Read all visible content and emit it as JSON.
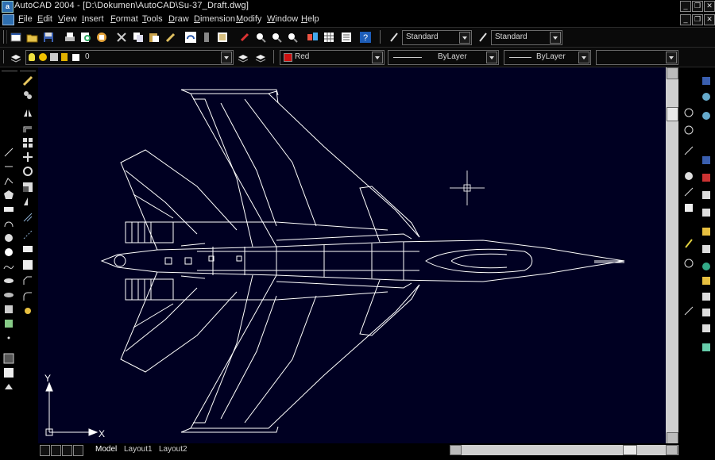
{
  "window": {
    "title": "AutoCAD 2004 - [D:\\Dokumen\\AutoCAD\\Su-37_Draft.dwg]",
    "app_icon_letter": "a"
  },
  "menu": [
    "File",
    "Edit",
    "View",
    "Insert",
    "Format",
    "Tools",
    "Draw",
    "Dimension",
    "Modify",
    "Window",
    "Help"
  ],
  "styles_toolbar": {
    "text_style": "Standard",
    "dim_style": "Standard"
  },
  "layers_toolbar": {
    "layer": "0",
    "color": "Red",
    "color_hex": "#cc1111",
    "linetype": "ByLayer",
    "lineweight": "ByLayer",
    "plotstyle": ""
  },
  "ucs": {
    "x_label": "X",
    "y_label": "Y"
  },
  "tabs": [
    "Model",
    "Layout1",
    "Layout2"
  ],
  "active_tab": "Model",
  "colors": {
    "canvas_bg": "#000022",
    "linework": "#ffffff"
  },
  "icons": [
    "new-icon",
    "open-icon",
    "save-icon",
    "plot-icon",
    "plot-preview-icon",
    "publish-icon",
    "cut-icon",
    "copy-icon",
    "paste-icon",
    "match-properties-icon",
    "undo-icon",
    "redo-icon",
    "pan-icon",
    "zoom-realtime-icon",
    "zoom-window-icon",
    "zoom-previous-icon",
    "properties-icon",
    "design-center-icon",
    "tool-palettes-icon",
    "help-icon",
    "layer-manager-icon",
    "layer-state-icon",
    "make-object-layer-current-icon",
    "layer-previous-icon"
  ]
}
